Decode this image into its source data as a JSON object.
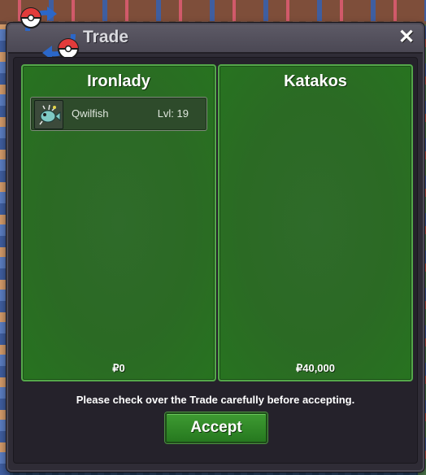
{
  "window": {
    "title": "Trade",
    "close_glyph": "✕",
    "close_icon": "close-icon",
    "logo_icon": "trade-pokeball-arrows-icon"
  },
  "left_player": {
    "name": "Ironlady",
    "items": [
      {
        "icon": "qwilfish-icon",
        "name": "Qwilfish",
        "level": "Lvl: 19"
      }
    ],
    "money": "₽0"
  },
  "right_player": {
    "name": "Katakos",
    "items": [],
    "money": "₽40,000"
  },
  "notice": "Please check over the Trade carefully before accepting.",
  "accept_label": "Accept",
  "colors": {
    "panel_green": "#2b6a24",
    "panel_border": "#54a84a",
    "accept": "#3e9b32"
  }
}
